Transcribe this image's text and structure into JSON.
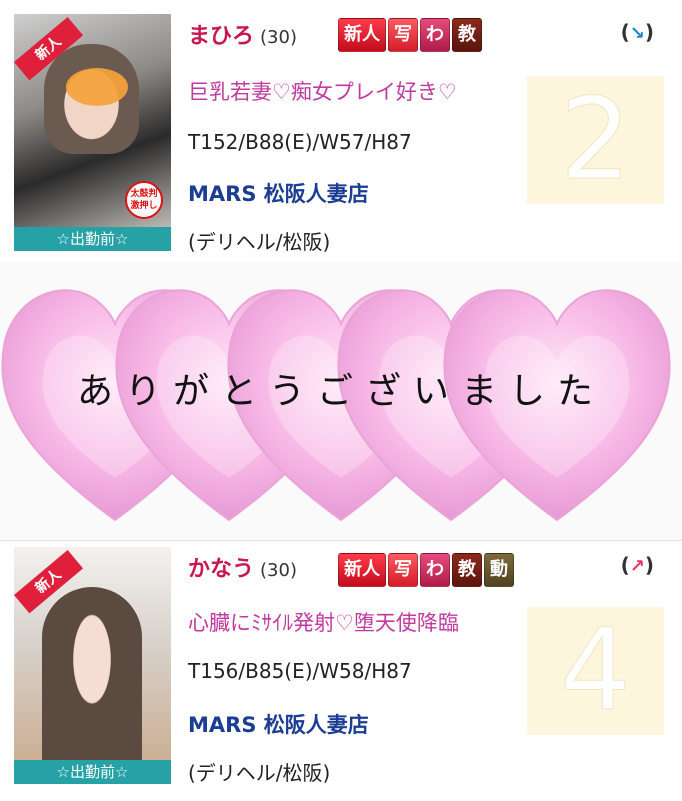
{
  "listing": [
    {
      "ribbon": "新人",
      "stamp": "太鼓判\n激押し",
      "status": "☆出勤前☆",
      "name": "まひろ",
      "age": "(30)",
      "badges": [
        "新人",
        "写",
        "わ",
        "教"
      ],
      "trend": {
        "open": "(",
        "arrow": "↘",
        "close": ")"
      },
      "catch": "巨乳若妻♡痴女プレイ好き♡",
      "size": "T152/B88(E)/W57/H87",
      "shop": "MARS 松阪人妻店",
      "area": "(デリヘル/松阪)",
      "rank": "2"
    },
    {
      "ribbon": "新人",
      "status": "☆出勤前☆",
      "name": "かなう",
      "age": "(30)",
      "badges": [
        "新人",
        "写",
        "わ",
        "教",
        "動"
      ],
      "trend": {
        "open": "(",
        "arrow": "↗",
        "close": ")"
      },
      "catch": "心臓にﾐｻｲﾙ発射♡堕天使降臨",
      "size": "T156/B85(E)/W58/H87",
      "shop": "MARS 松阪人妻店",
      "area": "(デリヘル/松阪)",
      "rank": "4"
    }
  ],
  "overlay": {
    "message": "ありがとうございました",
    "heart_color": "#f7b8e6"
  }
}
